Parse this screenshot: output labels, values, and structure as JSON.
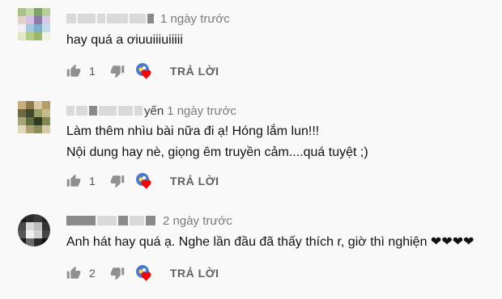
{
  "comments": [
    {
      "author_tail": "",
      "time": "1 ngày trước",
      "lines": [
        "hay quá a ơiuuiiiuiiiii"
      ],
      "like_count": "1",
      "reply_label": "TRẢ LỜI",
      "avatar_icon": "pixelated-avatar",
      "avatar_colors": [
        "#a9c28a",
        "#c9d6a8",
        "#7ea266",
        "#b8cf9a",
        "#e0d5c8",
        "#d7c0e6",
        "#8c7aa8",
        "#d9c9e8",
        "#f2eef5",
        "#a5c7d9",
        "#7fb0c9",
        "#c4dbe8",
        "#dfe9c6",
        "#b4cb84",
        "#9cb86e",
        "#eef3e4"
      ]
    },
    {
      "author_tail": "yến",
      "time": "1 ngày trước",
      "lines": [
        "Làm thêm nhìu bài nữa đi ạ! Hóng lắm lun!!!",
        "Nội dung hay nè, giọng êm truyền cảm....quá  tuyệt ;)"
      ],
      "like_count": "1",
      "reply_label": "TRẢ LỜI",
      "avatar_icon": "pixelated-avatar",
      "avatar_colors": [
        "#c8b07a",
        "#8f7a4a",
        "#d9c9a2",
        "#b59c66",
        "#6d6a44",
        "#3f4a2e",
        "#9aa06a",
        "#c6b98c",
        "#a8a47a",
        "#5d6b3d",
        "#2f3a22",
        "#7c8a52",
        "#e2d8bc",
        "#b0a274",
        "#8a8d5e",
        "#d5ccaa"
      ]
    },
    {
      "author_tail": "",
      "time": "2 ngày trước",
      "lines": [
        "Anh hát hay quá ạ. Nghe lần đầu đã thấy thích r, giờ thì nghiện ❤❤❤❤"
      ],
      "like_count": "2",
      "reply_label": "TRẢ LỜI",
      "avatar_icon": "pixelated-avatar",
      "avatar_colors": [
        "#1c1c1c",
        "#2b2b2b",
        "#3a3a3a",
        "#222222",
        "#4a4a4a",
        "#d8d8d8",
        "#bdbdbd",
        "#333333",
        "#555555",
        "#efefef",
        "#cfcfcf",
        "#444444",
        "#1a1a1a",
        "#6a6a6a",
        "#2a2a2a",
        "#111111"
      ]
    }
  ],
  "icons": {
    "like": "thumbs-up-icon",
    "dislike": "thumbs-down-icon",
    "heart": "creator-heart-icon"
  },
  "colors": {
    "background": "#f9f9f9",
    "heart": "#ff0000",
    "creator_avatar": "#4a7bd0"
  }
}
